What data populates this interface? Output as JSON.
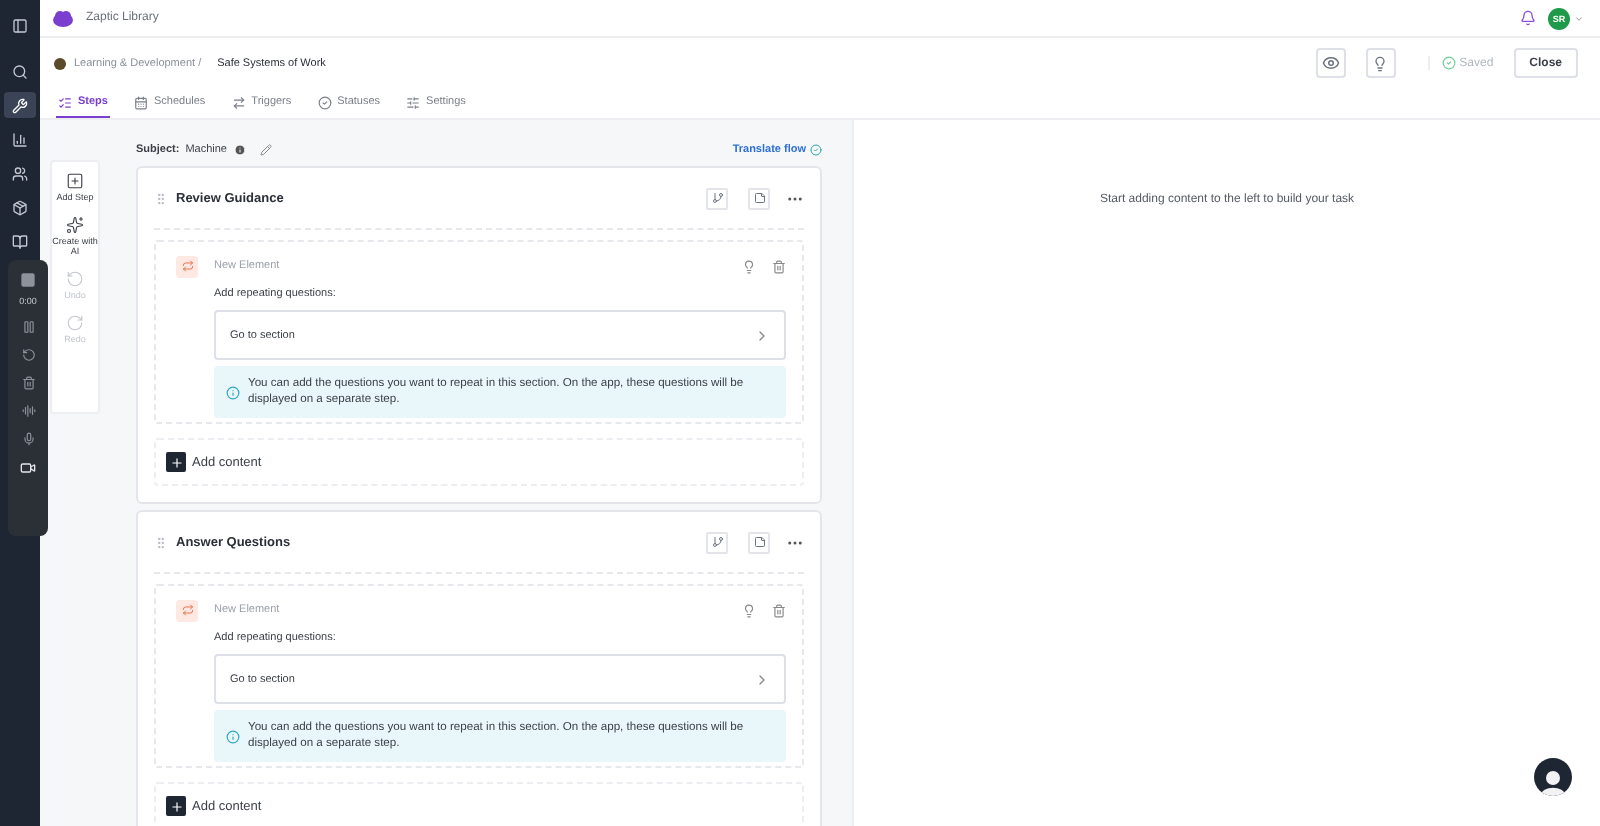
{
  "app": {
    "title": "Zaptic Library",
    "avatar": "SR"
  },
  "nav": [
    {
      "kind": "panel",
      "selected": false
    },
    {
      "kind": "search",
      "selected": false
    },
    {
      "kind": "wrench",
      "selected": true
    },
    {
      "kind": "chart",
      "selected": false
    },
    {
      "kind": "people",
      "selected": false
    },
    {
      "kind": "box",
      "selected": false
    },
    {
      "kind": "book",
      "selected": false
    }
  ],
  "breadcrumb": {
    "parent": "Learning & Development /",
    "current": "Safe Systems of Work"
  },
  "actions": {
    "status": "Saved",
    "close": "Close"
  },
  "tabs": [
    {
      "label": "Steps",
      "kind": "steps",
      "selected": true
    },
    {
      "label": "Schedules",
      "kind": "schedules",
      "selected": false
    },
    {
      "label": "Triggers",
      "kind": "triggers",
      "selected": false
    },
    {
      "label": "Statuses",
      "kind": "statuses",
      "selected": false
    },
    {
      "label": "Settings",
      "kind": "settings",
      "selected": false
    }
  ],
  "tools": [
    {
      "label": "Add Step",
      "kind": "add",
      "disabled": false
    },
    {
      "label": "Create with AI",
      "kind": "ai",
      "disabled": false
    },
    {
      "label": "Undo",
      "kind": "undo",
      "disabled": true
    },
    {
      "label": "Redo",
      "kind": "redo",
      "disabled": true
    }
  ],
  "subject": {
    "label": "Subject:",
    "value": "Machine"
  },
  "translate": "Translate flow",
  "steps": [
    {
      "title": "Review Guidance",
      "element": {
        "name": "New Element",
        "prompt": "Add repeating questions:",
        "link": "Go to section",
        "info": "You can add the questions you want to repeat in this section. On the app, these questions will be displayed on a separate step."
      },
      "add": "Add content"
    },
    {
      "title": "Answer Questions",
      "element": {
        "name": "New Element",
        "prompt": "Add repeating questions:",
        "link": "Go to section",
        "info": "You can add the questions you want to repeat in this section. On the app, these questions will be displayed on a separate step."
      },
      "add": "Add content"
    }
  ],
  "preview": {
    "message": "Start adding content to the left to build your task"
  },
  "recorder": {
    "time": "0:00"
  }
}
